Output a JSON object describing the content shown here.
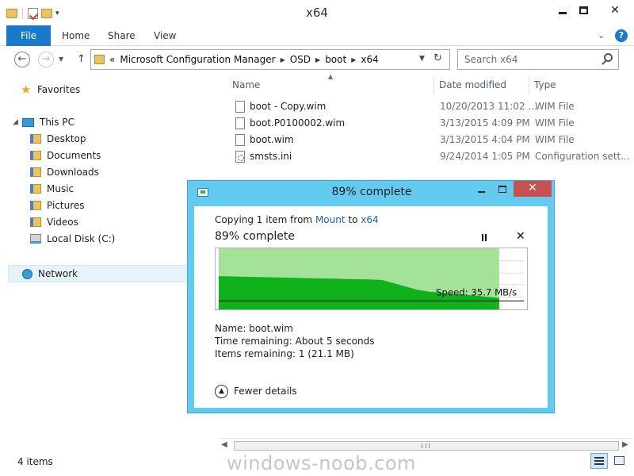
{
  "window": {
    "title": "x64"
  },
  "ribbon": {
    "tabs": [
      "File",
      "Home",
      "Share",
      "View"
    ]
  },
  "address": {
    "prefix": "«",
    "crumbs": [
      "Microsoft Configuration Manager",
      "OSD",
      "boot",
      "x64"
    ]
  },
  "search": {
    "placeholder": "Search x64"
  },
  "navpane": {
    "favorites": "Favorites",
    "this_pc": "This PC",
    "items": [
      "Desktop",
      "Documents",
      "Downloads",
      "Music",
      "Pictures",
      "Videos",
      "Local Disk (C:)"
    ],
    "network": "Network"
  },
  "columns": {
    "name": "Name",
    "date": "Date modified",
    "type": "Type"
  },
  "files": [
    {
      "name": "boot - Copy.wim",
      "date": "10/20/2013 11:02 ...",
      "type": "WIM File"
    },
    {
      "name": "boot.P0100002.wim",
      "date": "3/13/2015 4:09 PM",
      "type": "WIM File"
    },
    {
      "name": "boot.wim",
      "date": "3/13/2015 4:04 PM",
      "type": "WIM File"
    },
    {
      "name": "smsts.ini",
      "date": "9/24/2014 1:05 PM",
      "type": "Configuration sett..."
    }
  ],
  "status": {
    "count": "4 items"
  },
  "watermark": "windows-noob.com",
  "dialog": {
    "title": "89% complete",
    "copy_prefix": "Copying 1 item from",
    "source": "Mount",
    "to": "to",
    "dest": "x64",
    "heading": "89% complete",
    "speed": "Speed: 35.7 MB/s",
    "name_label": "Name:",
    "name_value": "boot.wim",
    "time_label": "Time remaining:",
    "time_value": "About 5 seconds",
    "items_label": "Items remaining:",
    "items_value": "1 (21.1 MB)",
    "fewer": "Fewer details",
    "progress": 0.92,
    "colors": {
      "fill_light": "#a4e29a",
      "fill_dark": "#10b21c",
      "titlebar": "#63cbf0",
      "close": "#c75050"
    }
  }
}
